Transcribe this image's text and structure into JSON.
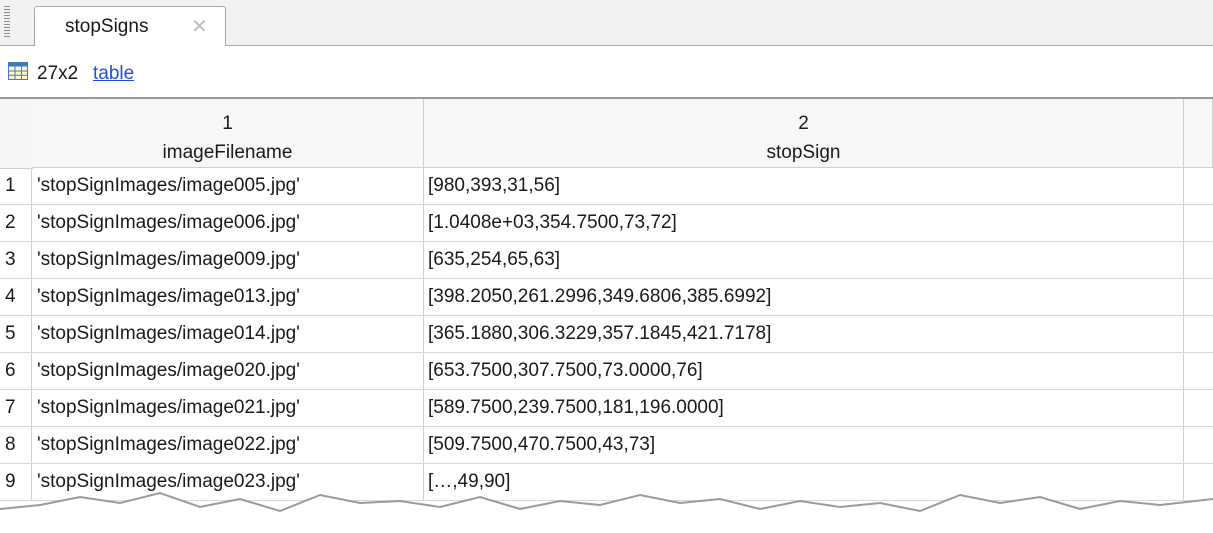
{
  "tab": {
    "label": "stopSigns",
    "close_glyph": "✕"
  },
  "info": {
    "size": "27x2",
    "link": "table"
  },
  "columns": [
    {
      "index": "1",
      "name": "imageFilename"
    },
    {
      "index": "2",
      "name": "stopSign"
    }
  ],
  "rows": [
    {
      "n": "1",
      "file": "'stopSignImages/image005.jpg'",
      "box": "[980,393,31,56]"
    },
    {
      "n": "2",
      "file": "'stopSignImages/image006.jpg'",
      "box": "[1.0408e+03,354.7500,73,72]"
    },
    {
      "n": "3",
      "file": "'stopSignImages/image009.jpg'",
      "box": "[635,254,65,63]"
    },
    {
      "n": "4",
      "file": "'stopSignImages/image013.jpg'",
      "box": "[398.2050,261.2996,349.6806,385.6992]"
    },
    {
      "n": "5",
      "file": "'stopSignImages/image014.jpg'",
      "box": "[365.1880,306.3229,357.1845,421.7178]"
    },
    {
      "n": "6",
      "file": "'stopSignImages/image020.jpg'",
      "box": "[653.7500,307.7500,73.0000,76]"
    },
    {
      "n": "7",
      "file": "'stopSignImages/image021.jpg'",
      "box": "[589.7500,239.7500,181,196.0000]"
    },
    {
      "n": "8",
      "file": "'stopSignImages/image022.jpg'",
      "box": "[509.7500,470.7500,43,73]"
    },
    {
      "n": "9",
      "file": "'stopSignImages/image023.jpg'",
      "box": "[…,49,90]"
    }
  ],
  "icons": {
    "table": "table-grid-icon",
    "close": "close-icon"
  },
  "colors": {
    "link": "#1f4fd8",
    "tab_bg": "#f2f2f2",
    "grid_line": "#cfcfcf"
  }
}
